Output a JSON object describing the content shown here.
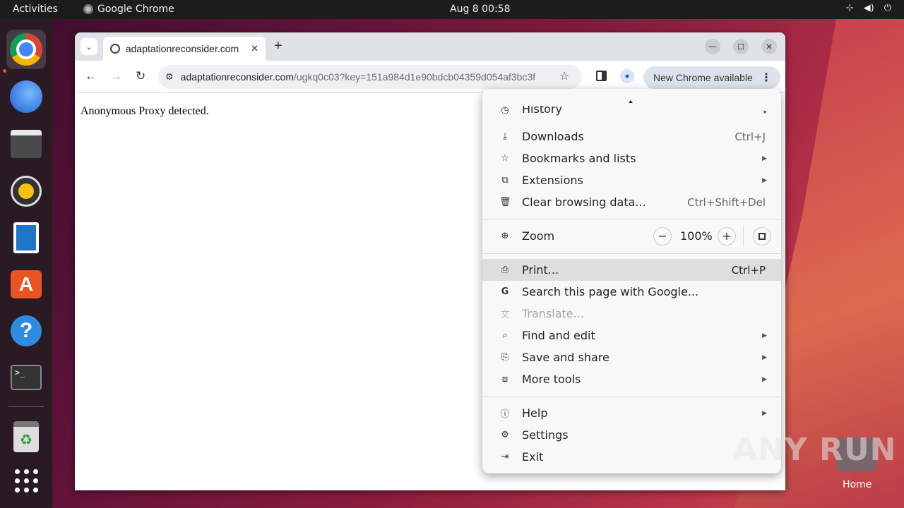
{
  "topbar": {
    "activities": "Activities",
    "app_name": "Google Chrome",
    "clock": "Aug 8  00:58",
    "tray_icons": [
      "network-icon",
      "volume-icon",
      "power-icon"
    ]
  },
  "dock": {
    "items": [
      "google-chrome",
      "thunderbird",
      "files",
      "rhythmbox",
      "libreoffice-writer",
      "app-center",
      "help",
      "terminal",
      "trash",
      "show-apps"
    ]
  },
  "browser": {
    "tab_title": "adaptationreconsider.com",
    "url_host": "adaptationreconsider.com",
    "url_path": "/ugkq0c03?key=151a984d1e90bdcb04359d054af3bc3f",
    "update_label": "New Chrome available",
    "page_text": "Anonymous Proxy detected."
  },
  "menu": {
    "history_label": "History",
    "items_top": [
      {
        "label": "Downloads",
        "shortcut": "Ctrl+J",
        "icon": "download-icon"
      },
      {
        "label": "Bookmarks and lists",
        "shortcut": "",
        "icon": "star-icon",
        "submenu": true
      },
      {
        "label": "Extensions",
        "shortcut": "",
        "icon": "puzzle-icon",
        "submenu": true
      },
      {
        "label": "Clear browsing data...",
        "shortcut": "Ctrl+Shift+Del",
        "icon": "trash-icon"
      }
    ],
    "zoom": {
      "label": "Zoom",
      "minus": "−",
      "value": "100%",
      "plus": "+"
    },
    "items_mid": [
      {
        "label": "Print...",
        "shortcut": "Ctrl+P",
        "icon": "printer-icon",
        "highlighted": true
      },
      {
        "label": "Search this page with Google...",
        "shortcut": "",
        "icon": "google-icon"
      },
      {
        "label": "Translate...",
        "shortcut": "",
        "icon": "translate-icon",
        "disabled": true
      },
      {
        "label": "Find and edit",
        "shortcut": "",
        "icon": "find-icon",
        "submenu": true
      },
      {
        "label": "Save and share",
        "shortcut": "",
        "icon": "save-icon",
        "submenu": true
      },
      {
        "label": "More tools",
        "shortcut": "",
        "icon": "toolbox-icon",
        "submenu": true
      }
    ],
    "items_bottom": [
      {
        "label": "Help",
        "shortcut": "",
        "icon": "help-icon",
        "submenu": true
      },
      {
        "label": "Settings",
        "shortcut": "",
        "icon": "gear-icon"
      },
      {
        "label": "Exit",
        "shortcut": "",
        "icon": "exit-icon"
      }
    ]
  },
  "desktop": {
    "watermark": "ANY RUN",
    "home_label": "Home"
  }
}
